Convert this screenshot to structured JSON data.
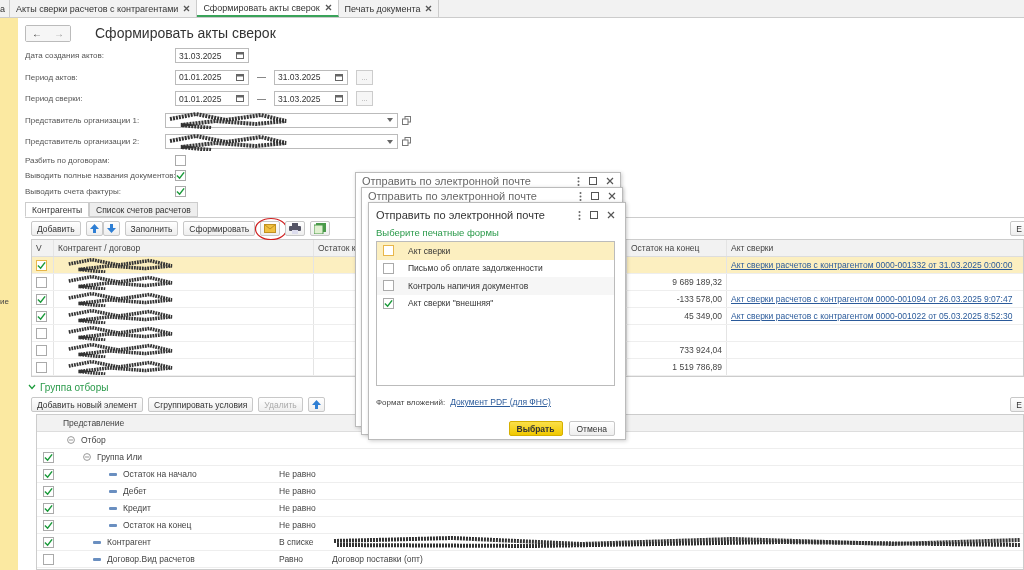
{
  "tabs": [
    {
      "label": "а",
      "selected": false,
      "closable": false
    },
    {
      "label": "Акты сверки расчетов с контрагентами",
      "selected": false,
      "closable": true
    },
    {
      "label": "Сформировать акты сверок",
      "selected": true,
      "closable": true
    },
    {
      "label": "Печать документа",
      "selected": false,
      "closable": true
    }
  ],
  "sidebar": {
    "text": "ие"
  },
  "nav": {
    "back": "←",
    "forward": "→"
  },
  "title": "Сформировать акты сверок",
  "form": [
    {
      "kind": "date",
      "label": "Дата создания актов:",
      "value": "31.03.2025"
    },
    {
      "kind": "period",
      "label": "Период актов:",
      "from": "01.01.2025",
      "dash": "—",
      "to": "31.03.2025",
      "more": "..."
    },
    {
      "kind": "period",
      "label": "Период сверки:",
      "from": "01.01.2025",
      "dash": "—",
      "to": "31.03.2025",
      "more": "..."
    },
    {
      "kind": "ref",
      "label": "Представитель организации 1:",
      "redacted": true
    },
    {
      "kind": "ref",
      "label": "Представитель организации 2:",
      "redacted": true
    },
    {
      "kind": "check",
      "label": "Разбить по договорам:",
      "checked": false
    },
    {
      "kind": "check",
      "label": "Выводить полные названия документов:",
      "checked": true
    },
    {
      "kind": "check",
      "label": "Выводить счета фактуры:",
      "checked": true
    }
  ],
  "panel_tabs": [
    {
      "label": "Контрагенты",
      "selected": true
    },
    {
      "label": "Список счетов расчетов",
      "selected": false
    }
  ],
  "toolbar": {
    "buttons": [
      {
        "kind": "text",
        "label": "Добавить"
      },
      {
        "kind": "arrows"
      },
      {
        "kind": "text",
        "label": "Заполнить"
      },
      {
        "kind": "text",
        "label": "Сформировать"
      },
      {
        "kind": "mail",
        "circled": true
      },
      {
        "kind": "print",
        "circled": false
      },
      {
        "kind": "report",
        "circled": false
      }
    ],
    "right_button": "Е"
  },
  "table": {
    "columns": [
      "V",
      "Контрагент / договор",
      "Остаток к",
      "Остаток на конец",
      "Акт сверки"
    ],
    "rows": [
      {
        "checked": true,
        "selected": true,
        "redacted": true,
        "end": "",
        "link": "Акт сверки расчетов с контрагентом 0000-001332 от 31.03.2025 0:00:00"
      },
      {
        "checked": false,
        "selected": false,
        "redacted": true,
        "end": "9 689 189,32",
        "link": ""
      },
      {
        "checked": true,
        "selected": false,
        "redacted": true,
        "end": "-133 578,00",
        "link": "Акт сверки расчетов с контрагентом 0000-001094 от 26.03.2025 9:07:47"
      },
      {
        "checked": true,
        "selected": false,
        "redacted": true,
        "end": "45 349,00",
        "link": "Акт сверки расчетов с контрагентом 0000-001022 от 05.03.2025 8:52:30"
      },
      {
        "checked": false,
        "selected": false,
        "redacted": true,
        "end": "",
        "link": ""
      },
      {
        "checked": false,
        "selected": false,
        "redacted": true,
        "end": "733 924,04",
        "link": ""
      },
      {
        "checked": false,
        "selected": false,
        "redacted": true,
        "end": "1 519 786,89",
        "link": ""
      }
    ]
  },
  "filter": {
    "title": "Группа отборы",
    "expanded": true,
    "buttons": [
      {
        "label": "Добавить новый элемент",
        "disabled": false
      },
      {
        "label": "Сгруппировать условия",
        "disabled": false
      },
      {
        "label": "Удалить",
        "disabled": true
      }
    ],
    "right_button": "Е",
    "column": "Представление",
    "rows": [
      {
        "kind": "root",
        "label": "Отбор",
        "expanded": true,
        "children": [
          {
            "kind": "group",
            "label": "Группа Или",
            "checked": true,
            "expanded": true,
            "children": [
              {
                "kind": "condition",
                "label": "Остаток на начало",
                "checked": true,
                "condition": "Не равно"
              },
              {
                "kind": "condition",
                "label": "Дебет",
                "checked": true,
                "condition": "Не равно"
              },
              {
                "kind": "condition",
                "label": "Кредит",
                "checked": true,
                "condition": "Не равно"
              },
              {
                "kind": "condition",
                "label": "Остаток на конец",
                "checked": true,
                "condition": "Не равно"
              }
            ]
          },
          {
            "kind": "condition",
            "label": "Контрагент",
            "checked": true,
            "condition": "В списке",
            "redacted": true
          },
          {
            "kind": "condition",
            "label": "Договор.Вид расчетов",
            "checked": false,
            "condition": "Равно",
            "value": "Договор поставки (опт)"
          }
        ]
      }
    ]
  },
  "back_dialogs": [
    {
      "title": "Отправить по электронной почте"
    },
    {
      "title": "Отправить по электронной почте"
    }
  ],
  "dialog": {
    "title": "Отправить по электронной почте",
    "subtitle": "Выберите печатные формы",
    "items": [
      {
        "label": "Акт сверки",
        "checked": false,
        "selected": true
      },
      {
        "label": "Письмо об оплате задолженности",
        "checked": false,
        "selected": false
      },
      {
        "label": "Контроль напичия документов",
        "checked": false,
        "selected": false
      },
      {
        "label": "Акт сверки \"внешняя\"",
        "checked": true,
        "selected": false
      }
    ],
    "format_label": "Формат вложений:",
    "format_link": "Документ PDF (для ФНС)",
    "buttons": [
      {
        "label": "Выбрать",
        "default": true
      },
      {
        "label": "Отмена",
        "default": false
      }
    ]
  }
}
